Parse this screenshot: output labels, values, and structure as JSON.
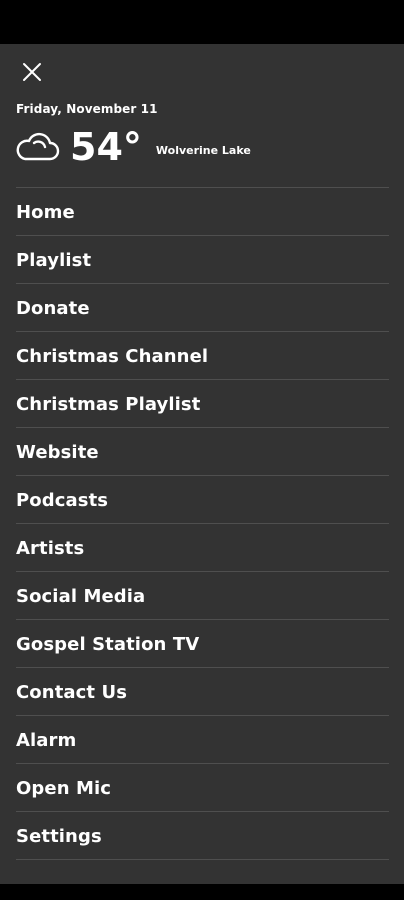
{
  "header": {
    "close_icon": "close-icon",
    "date": "Friday, November 11",
    "weather_icon": "cloud-icon",
    "temperature": "54°",
    "location": "Wolverine Lake"
  },
  "menu": {
    "items": [
      {
        "label": "Home"
      },
      {
        "label": "Playlist"
      },
      {
        "label": "Donate"
      },
      {
        "label": "Christmas Channel"
      },
      {
        "label": "Christmas Playlist"
      },
      {
        "label": "Website"
      },
      {
        "label": "Podcasts"
      },
      {
        "label": "Artists"
      },
      {
        "label": "Social Media"
      },
      {
        "label": "Gospel Station TV"
      },
      {
        "label": "Contact Us"
      },
      {
        "label": "Alarm"
      },
      {
        "label": "Open Mic"
      },
      {
        "label": "Settings"
      }
    ]
  },
  "colors": {
    "drawer_background": "#333333",
    "divider": "#4f4f4f",
    "text": "#ffffff"
  }
}
